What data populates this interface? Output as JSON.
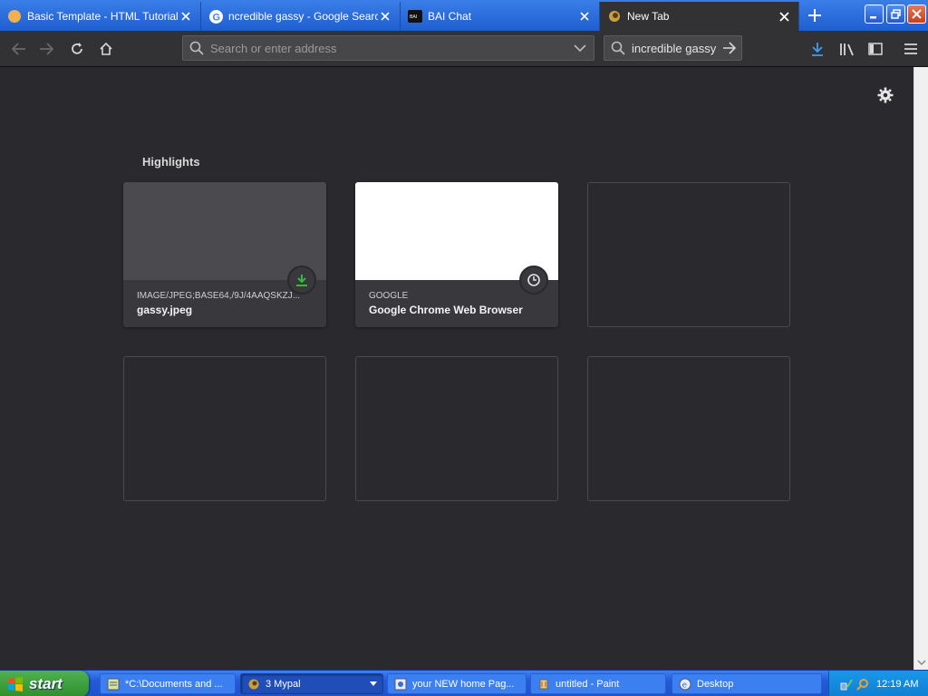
{
  "browser": {
    "tabs": [
      {
        "title": "Basic Template - HTML Tutorial",
        "favicon": "orange-circle-icon",
        "active": false
      },
      {
        "title": "ncredible gassy - Google Search",
        "favicon": "google-g-icon",
        "active": false
      },
      {
        "title": "BAI Chat",
        "favicon": "bai-logo-icon",
        "active": false
      },
      {
        "title": "New Tab",
        "favicon": "firefox-icon",
        "active": true
      }
    ],
    "urlbar": {
      "placeholder": "Search or enter address",
      "value": ""
    },
    "searchbar": {
      "value": "incredible gassy"
    }
  },
  "newtab": {
    "section_title": "Highlights",
    "cards": [
      {
        "source": "IMAGE/JPEG;BASE64,/9J/4AAQSKZJ...",
        "name": "gassy.jpeg",
        "badge": "download-icon",
        "thumb_color": "#4a4a4f"
      },
      {
        "source": "GOOGLE",
        "name": "Google Chrome Web Browser",
        "badge": "clock-icon",
        "thumb_color": "#ffffff"
      }
    ]
  },
  "taskbar": {
    "start_label": "start",
    "tasks": [
      {
        "label": "*C:\\Documents and ...",
        "icon": "notepad-icon"
      },
      {
        "label": "3 Mypal",
        "icon": "mypal-icon",
        "active": true
      },
      {
        "label": "your NEW home Pag...",
        "icon": "browser-page-icon"
      },
      {
        "label": "untitled - Paint",
        "icon": "paint-icon"
      },
      {
        "label": "Desktop",
        "icon": "desktop-icon"
      }
    ],
    "clock": "12:19 AM"
  },
  "colors": {
    "accent_download": "#2fbd3a",
    "content_bg": "#2a2a2e",
    "toolbar_bg": "#323234"
  }
}
